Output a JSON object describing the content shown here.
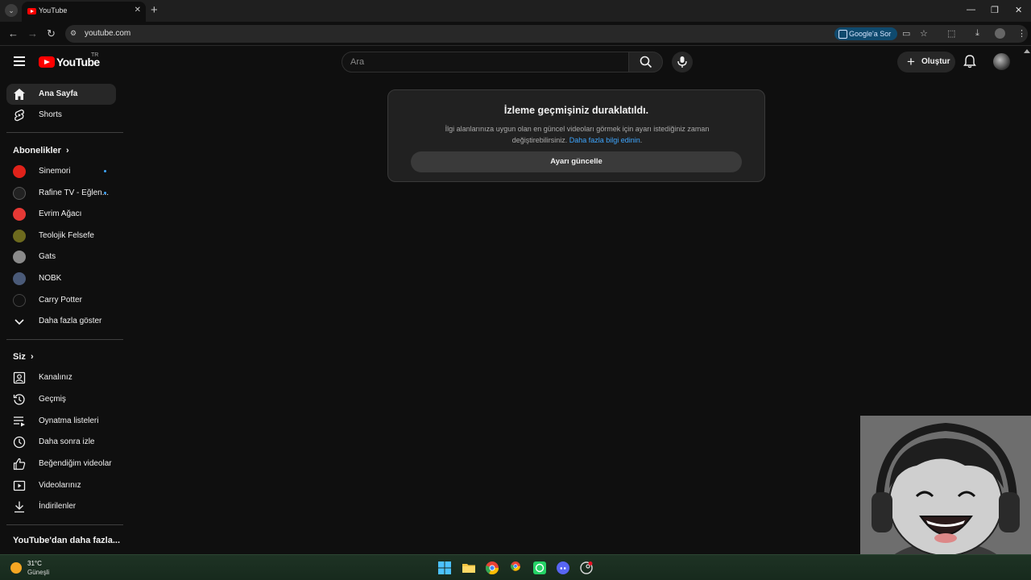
{
  "browser": {
    "tab_title": "YouTube",
    "url": "youtube.com",
    "google_ask": "Google'a Sor"
  },
  "header": {
    "logo_text": "YouTube",
    "region": "TR",
    "search_placeholder": "Ara",
    "create_label": "Oluştur"
  },
  "sidebar": {
    "home": "Ana Sayfa",
    "shorts": "Shorts",
    "subscriptions_header": "Abonelikler",
    "channels": [
      {
        "name": "Sinemori",
        "new": true,
        "color": "#e0221a"
      },
      {
        "name": "Rafine TV - Eğlen...",
        "new": true,
        "color": "#222222"
      },
      {
        "name": "Evrim Ağacı",
        "new": false,
        "color": "#e53935"
      },
      {
        "name": "Teolojik Felsefe",
        "new": false,
        "color": "#6d6a1e"
      },
      {
        "name": "Gats",
        "new": false,
        "color": "#8a8a8a"
      },
      {
        "name": "NOBK",
        "new": false,
        "color": "#4a5a78"
      },
      {
        "name": "Carry Potter",
        "new": false,
        "color": "#111111"
      }
    ],
    "show_more": "Daha fazla göster",
    "you_header": "Siz",
    "you_items": [
      {
        "label": "Kanalınız",
        "icon": "account-box-icon"
      },
      {
        "label": "Geçmiş",
        "icon": "history-icon"
      },
      {
        "label": "Oynatma listeleri",
        "icon": "playlist-icon"
      },
      {
        "label": "Daha sonra izle",
        "icon": "clock-icon"
      },
      {
        "label": "Beğendiğim videolar",
        "icon": "thumbs-up-icon"
      },
      {
        "label": "Videolarınız",
        "icon": "video-icon"
      },
      {
        "label": "İndirilenler",
        "icon": "download-icon"
      }
    ],
    "more_from_youtube": "YouTube'dan daha fazla..."
  },
  "notice": {
    "title": "İzleme geçmişiniz duraklatıldı.",
    "body": "İlgi alanlarınıza uygun olan en güncel videoları görmek için ayarı istediğiniz zaman değiştirebilirsiniz.",
    "link": "Daha fazla bilgi edinin",
    "button": "Ayarı güncelle"
  },
  "taskbar": {
    "temperature": "31°C",
    "weather": "Güneşli"
  },
  "colors": {
    "background": "#0f0f0f",
    "brand_red": "#ff0000",
    "link_blue": "#3ea6ff",
    "taskbar": "#1e3324"
  }
}
